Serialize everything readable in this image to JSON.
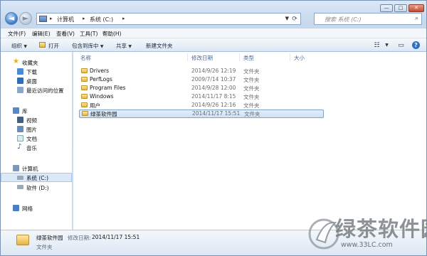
{
  "window_controls": {
    "minimize": "—",
    "maximize": "□",
    "close": "✕"
  },
  "nav": {
    "back": "◄",
    "forward": "►",
    "dropdown": "▼"
  },
  "address": {
    "crumbs": [
      "计算机",
      "系统 (C:)"
    ],
    "separator": "▸",
    "dropdown": "▼",
    "refresh": "⟳"
  },
  "search": {
    "placeholder": "搜索 系统 (C:)",
    "icon": "⌕"
  },
  "menubar": [
    "文件(F)",
    "编辑(E)",
    "查看(V)",
    "工具(T)",
    "帮助(H)"
  ],
  "toolbar": {
    "organize": "组织",
    "open": "打开",
    "include_library": "包含到库中",
    "share": "共享",
    "new_folder": "新建文件夹",
    "dd": "▼",
    "view_icon": "☷",
    "pane_icon": "▭",
    "help_icon": "?"
  },
  "sidebar": {
    "favorites": "收藏夹",
    "fav_items": [
      "下载",
      "桌面",
      "最近访问的位置"
    ],
    "libraries": "库",
    "lib_items": [
      "视频",
      "图片",
      "文档",
      "音乐"
    ],
    "computer": "计算机",
    "drives": [
      "系统 (C:)",
      "软件 (D:)"
    ],
    "network": "网络"
  },
  "columns": [
    "名称",
    "修改日期",
    "类型",
    "大小"
  ],
  "files": [
    {
      "name": "Drivers",
      "date": "2014/9/26 12:19",
      "type": "文件夹"
    },
    {
      "name": "PerfLogs",
      "date": "2009/7/14 10:37",
      "type": "文件夹"
    },
    {
      "name": "Program Files",
      "date": "2014/9/28 12:00",
      "type": "文件夹"
    },
    {
      "name": "Windows",
      "date": "2014/11/17 8:15",
      "type": "文件夹"
    },
    {
      "name": "用户",
      "date": "2014/9/26 12:16",
      "type": "文件夹"
    },
    {
      "name": "绿茶软件园",
      "date": "2014/11/17 15:51",
      "type": "文件夹"
    }
  ],
  "details": {
    "name": "绿茶软件园",
    "modified_label": "修改日期:",
    "modified": "2014/11/17 15:51",
    "type": "文件夹"
  },
  "watermark": {
    "text": "绿茶软件园",
    "url": "www.33LC.com"
  },
  "colors": {
    "accent": "#3a78c6",
    "selection": "#cfe1f5",
    "folder": "#e3b545"
  }
}
